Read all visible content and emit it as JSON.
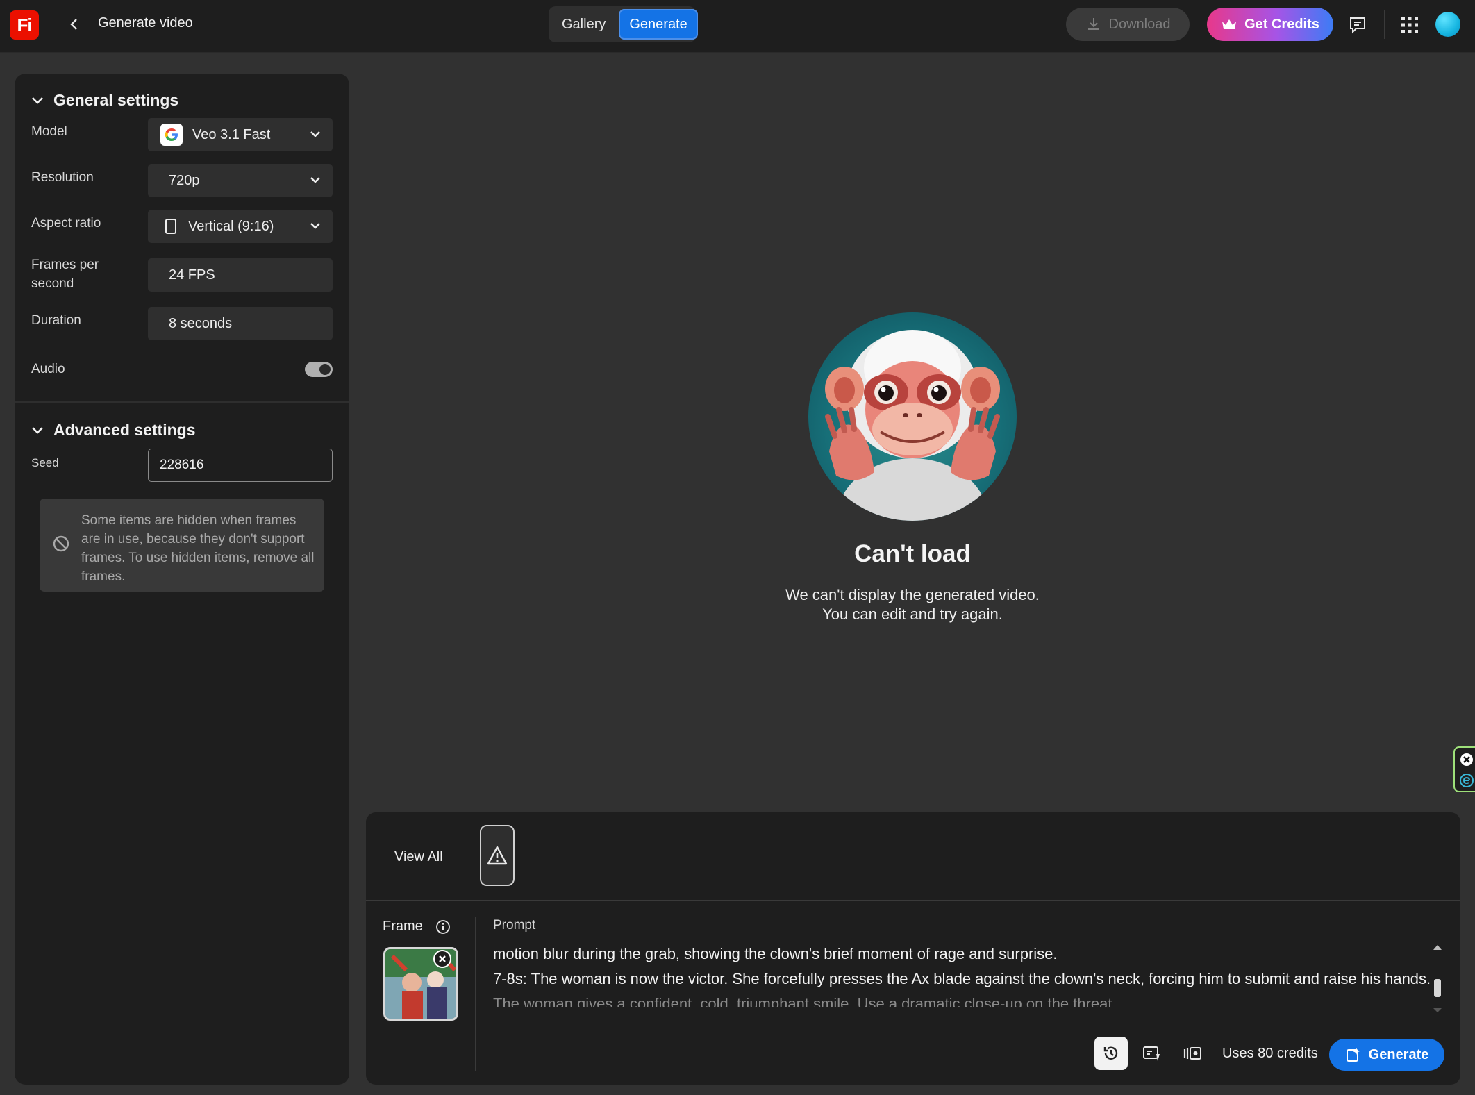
{
  "app": {
    "logo_text": "Fi",
    "page_title": "Generate video"
  },
  "header": {
    "tabs": [
      {
        "label": "Gallery"
      },
      {
        "label": "Generate"
      }
    ],
    "download_label": "Download",
    "get_credits_label": "Get Credits"
  },
  "general": {
    "title": "General settings",
    "model_label": "Model",
    "model_value": "Veo 3.1 Fast",
    "resolution_label": "Resolution",
    "resolution_value": "720p",
    "aspect_label": "Aspect ratio",
    "aspect_value": "Vertical (9:16)",
    "fps_label_1": "Frames per",
    "fps_label_2": "second",
    "fps_value": "24 FPS",
    "duration_label": "Duration",
    "duration_value": "8 seconds",
    "audio_label": "Audio",
    "audio_on": true
  },
  "advanced": {
    "title": "Advanced settings",
    "seed_label": "Seed",
    "seed_value": "228616",
    "note": "Some items are hidden when frames are in use, because they don't support frames. To use hidden items, remove all frames."
  },
  "center": {
    "title": "Can't load",
    "line1": "We can't display the generated video.",
    "line2": "You can edit and try again."
  },
  "bottom": {
    "view_all": "View All",
    "frame_label": "Frame",
    "prompt_label": "Prompt",
    "prompt_line1": "motion blur during the grab, showing the clown's brief moment of rage and surprise.",
    "prompt_line2": "7-8s: The woman is now the victor. She forcefully presses the Ax blade against the clown's neck, forcing him to submit and raise his hands.",
    "prompt_line3": "The woman gives a confident, cold, triumphant smile. Use a dramatic close-up on the threat.",
    "uses_credits": "Uses 80 credits",
    "generate_label": "Generate"
  },
  "colors": {
    "accent": "#1473e6",
    "logo": "#eb1000",
    "panel": "#1e1e1e",
    "canvas": "#313131"
  }
}
